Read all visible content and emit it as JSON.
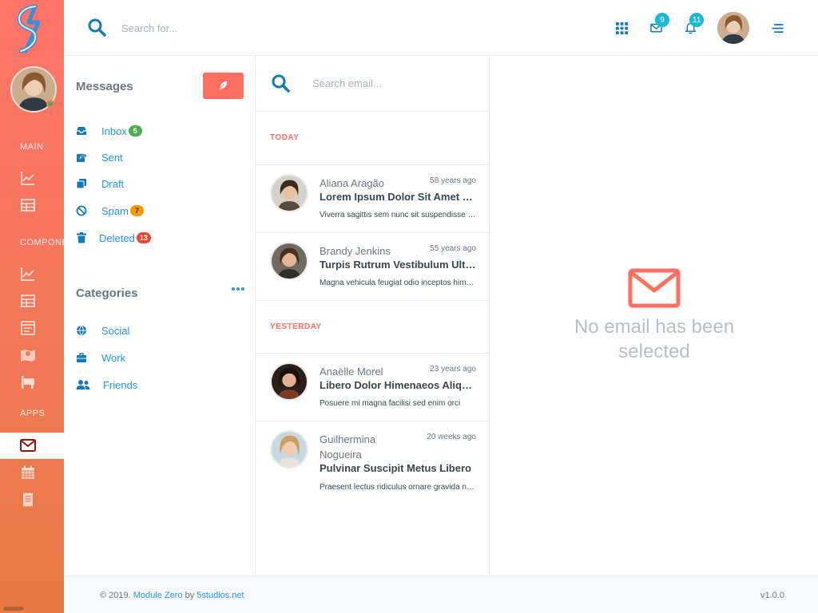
{
  "topbar": {
    "search_placeholder": "Search for...",
    "mail_count": "9",
    "notification_count": "11"
  },
  "sidebar": {
    "sections": [
      "MAIN",
      "COMPONENTS",
      "APPS"
    ]
  },
  "folders": {
    "title": "Messages",
    "items": [
      {
        "label": "Inbox",
        "count": "5",
        "badge_color": "#4caf50",
        "icon": "inbox-icon"
      },
      {
        "label": "Sent",
        "count": "",
        "icon": "share-icon"
      },
      {
        "label": "Draft",
        "count": "",
        "icon": "copy-icon"
      },
      {
        "label": "Spam",
        "count": "7",
        "badge_color": "#ff9800",
        "icon": "ban-icon"
      },
      {
        "label": "Deleted",
        "count": "13",
        "badge_color": "#f44336",
        "icon": "trash-icon"
      }
    ]
  },
  "categories": {
    "title": "Categories",
    "items": [
      {
        "label": "Social",
        "icon": "globe-icon"
      },
      {
        "label": "Work",
        "icon": "briefcase-icon"
      },
      {
        "label": "Friends",
        "icon": "users-icon"
      }
    ]
  },
  "email_list": {
    "search_placeholder": "Search email...",
    "groups": [
      {
        "label": "TODAY",
        "emails": [
          {
            "sender": "Aliana Aragão",
            "time": "58 years ago",
            "subject": "Lorem Ipsum Dolor Sit Amet Consectetur",
            "preview": "Viverra sagittis sem nunc sit suspendisse nibh"
          },
          {
            "sender": "Brandy Jenkins",
            "time": "55 years ago",
            "subject": "Turpis Rutrum Vestibulum Ultrices",
            "preview": "Magna vehicula feugiat odio inceptos himenaeos"
          }
        ]
      },
      {
        "label": "YESTERDAY",
        "emails": [
          {
            "sender": "Anaëlle Morel",
            "time": "23 years ago",
            "subject": "Libero Dolor Himenaeos Aliquet",
            "preview": "Posuere mi magna facilisi sed enim orci"
          },
          {
            "sender": "Guilhermina Nogueira",
            "time": "20 weeks ago",
            "subject": "Pulvinar Suscipit Metus Libero",
            "preview": "Praesent lectus ridiculus ornare gravida nunc"
          }
        ]
      }
    ]
  },
  "detail": {
    "empty_message": "No email has been selected"
  },
  "footer": {
    "copyright": "© 2019.",
    "product": "Module Zero",
    "by": "by",
    "company": "5studios.net",
    "version": "v1.0.0"
  },
  "colors": {
    "accent": "#ff6f61",
    "link": "#2196f3",
    "badge_cyan": "#1bb9d7"
  }
}
